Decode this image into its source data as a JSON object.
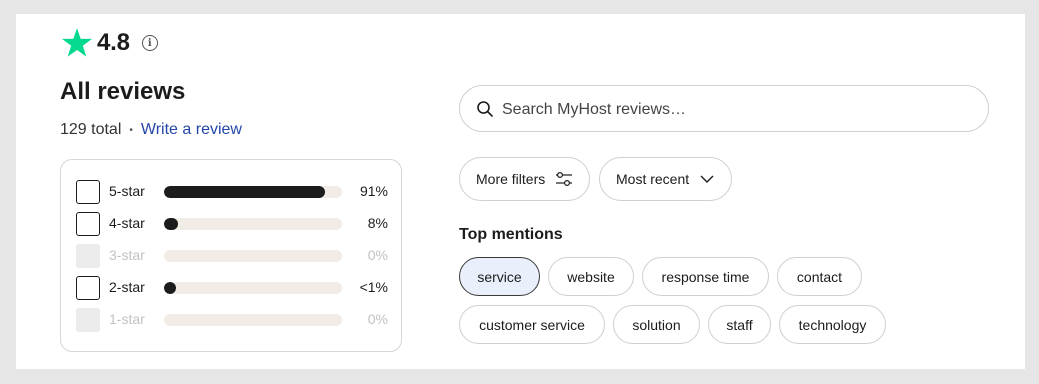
{
  "rating": {
    "value": "4.8",
    "star_color": "#04da8d"
  },
  "reviews": {
    "title": "All reviews",
    "total": "129 total",
    "separator": "•",
    "write_link": "Write a review"
  },
  "distribution": [
    {
      "label": "5-star",
      "percent": "91%",
      "fill": 0.91,
      "enabled": true
    },
    {
      "label": "4-star",
      "percent": "8%",
      "fill": 0.08,
      "enabled": true
    },
    {
      "label": "3-star",
      "percent": "0%",
      "fill": 0.0,
      "enabled": false
    },
    {
      "label": "2-star",
      "percent": "<1%",
      "fill": 0.005,
      "enabled": true
    },
    {
      "label": "1-star",
      "percent": "0%",
      "fill": 0.0,
      "enabled": false
    }
  ],
  "search": {
    "placeholder": "Search MyHost reviews…"
  },
  "filters": {
    "more_filters": "More filters",
    "sort": "Most recent"
  },
  "mentions": {
    "heading": "Top mentions",
    "chips": [
      "service",
      "website",
      "response time",
      "contact",
      "customer service",
      "solution",
      "staff",
      "technology"
    ],
    "active": "service"
  }
}
